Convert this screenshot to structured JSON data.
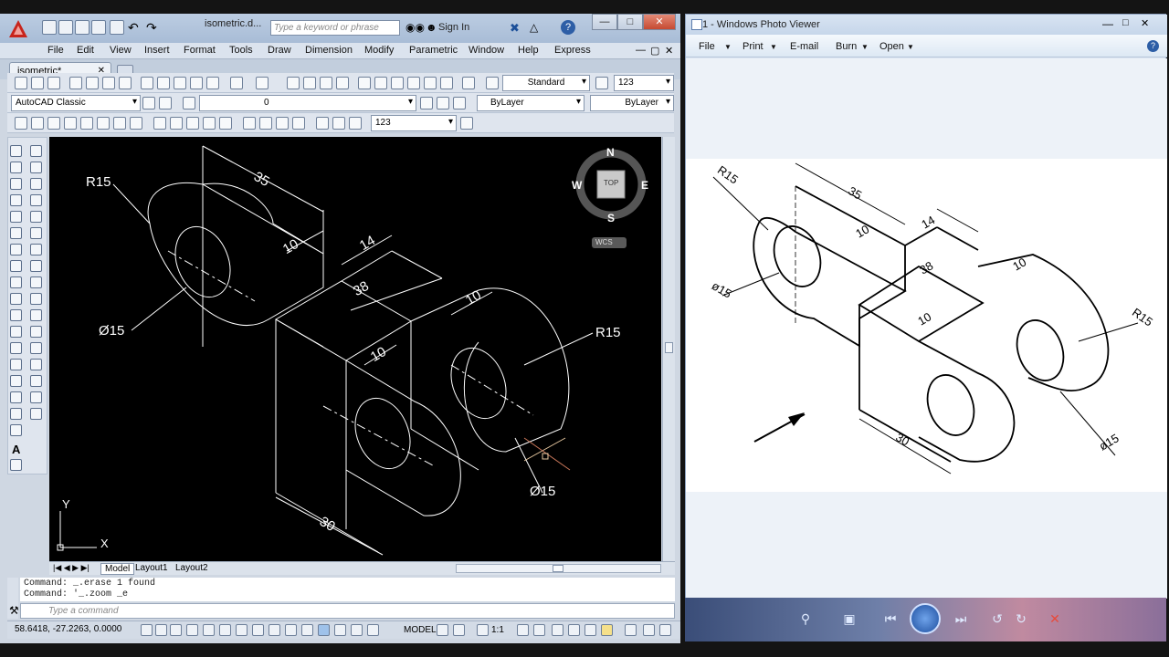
{
  "autocad": {
    "document_title": "isometric.d...",
    "search_placeholder": "Type a keyword or phrase",
    "sign_in": "Sign In",
    "menu": [
      "File",
      "Edit",
      "View",
      "Insert",
      "Format",
      "Tools",
      "Draw",
      "Dimension",
      "Modify",
      "Parametric",
      "Window",
      "Help",
      "Express"
    ],
    "doc_tab": "isometric*",
    "text_style": "Standard",
    "dim_value": "123",
    "workspace": "AutoCAD Classic",
    "layer": "0",
    "color": "ByLayer",
    "linetype": "ByLayer",
    "dim_style_value": "123",
    "viewcube": {
      "n": "N",
      "s": "S",
      "e": "E",
      "w": "W",
      "top": "TOP",
      "wcs": "WCS"
    },
    "ucs": {
      "x": "X",
      "y": "Y"
    },
    "dims": {
      "r15_a": "R15",
      "d35": "35",
      "d10_a": "10",
      "d14": "14",
      "d38": "38",
      "d10_b": "10",
      "d10_c": "10",
      "d15_a": "Ø15",
      "r15_b": "R15",
      "d15_b": "Ø15",
      "d30": "30"
    },
    "layout_tabs": [
      "Model",
      "Layout1",
      "Layout2"
    ],
    "command_history": [
      "Command: _.erase 1 found",
      "Command: '_.zoom _e"
    ],
    "command_placeholder": "Type a command",
    "coordinates": "58.6418, -27.2263, 0.0000",
    "status_model": "MODEL",
    "annotation_scale": "1:1"
  },
  "photo_viewer": {
    "title": "1 - Windows Photo Viewer",
    "menu": [
      "File",
      "Print",
      "E-mail",
      "Burn",
      "Open"
    ],
    "dims": {
      "r15_a": "R15",
      "d35": "35",
      "d10_a": "10",
      "d14": "14",
      "d38": "38",
      "d10_b": "10",
      "d15_a": "ø15",
      "d10_c": "10",
      "r15_b": "R15",
      "d15_b": "ø15",
      "d30": "30"
    }
  },
  "colors": {
    "canvas": "#000000",
    "drawing_line": "#ffffff",
    "acad_frame": "#cfd7e2",
    "pv_toolbar": "#3a4d78"
  }
}
